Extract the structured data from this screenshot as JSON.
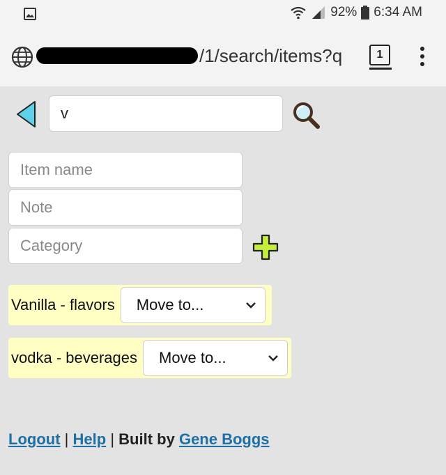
{
  "status_bar": {
    "battery": "92%",
    "time": "6:34 AM"
  },
  "browser": {
    "url_visible": "/1/search/items?q",
    "url_faded": "q",
    "tab_count": "1"
  },
  "search": {
    "value": "v"
  },
  "form": {
    "item_name_placeholder": "Item name",
    "note_placeholder": "Note",
    "category_placeholder": "Category"
  },
  "results": [
    {
      "label": "Vanilla - flavors",
      "move_label": "Move to..."
    },
    {
      "label": "vodka - beverages",
      "move_label": "Move to..."
    }
  ],
  "footer": {
    "logout": "Logout",
    "sep1": "|",
    "help": "Help",
    "sep2": "|",
    "built_by": "Built by",
    "author": "Gene Boggs"
  },
  "colors": {
    "page_bg": "#e3e3e3",
    "result_bg": "#ffffc4",
    "link": "#1d6fa4",
    "back_arrow": "#5fd0ea",
    "add_icon": "#c6ef3a"
  }
}
